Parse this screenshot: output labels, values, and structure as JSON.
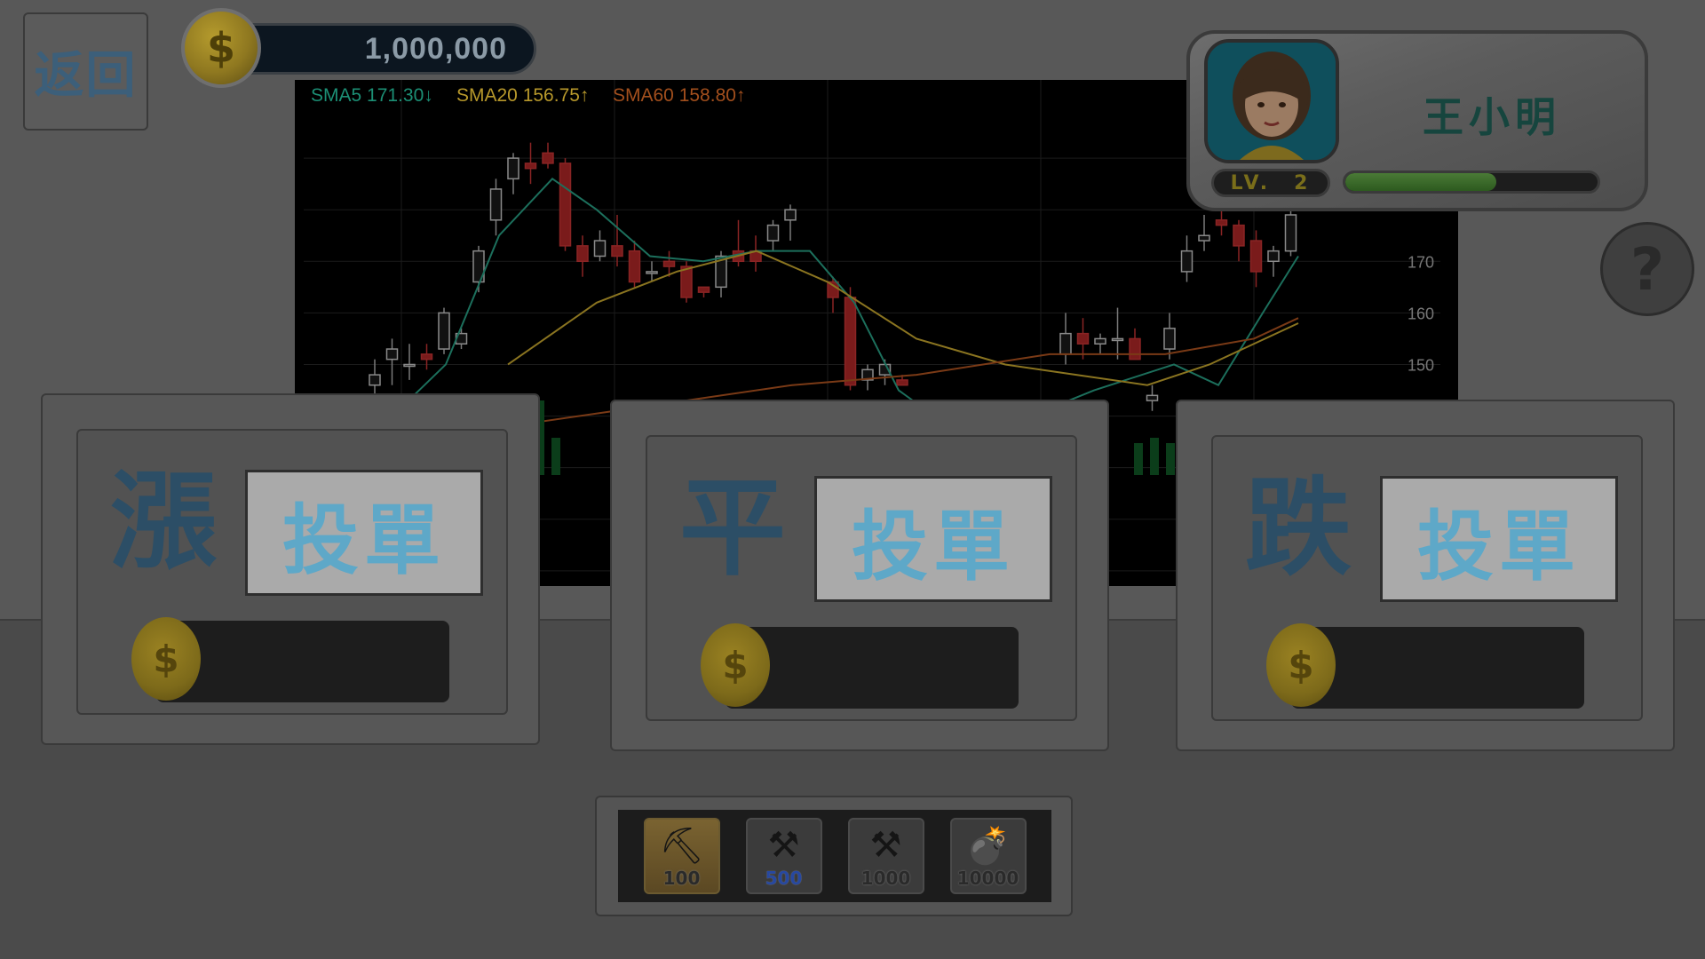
{
  "header": {
    "back_label": "返回",
    "coin_balance": "1,000,000",
    "coin_symbol": "$"
  },
  "chart_data": {
    "type": "candlestick",
    "indicators": [
      {
        "name": "SMA5",
        "value": "171.30",
        "direction": "down",
        "color": "#1c8f75"
      },
      {
        "name": "SMA20",
        "value": "156.75",
        "direction": "up",
        "color": "#b7982b"
      },
      {
        "name": "SMA60",
        "value": "158.80",
        "direction": "up",
        "color": "#a24f1d"
      }
    ],
    "y_ticks": [
      170,
      160,
      150
    ],
    "candles_visible_left": [
      {
        "o": 146,
        "h": 151,
        "l": 144,
        "c": 148
      },
      {
        "o": 151,
        "h": 155,
        "l": 146,
        "c": 153
      },
      {
        "o": 150,
        "h": 154,
        "l": 147,
        "c": 150
      },
      {
        "o": 152,
        "h": 154,
        "l": 149,
        "c": 151
      },
      {
        "o": 153,
        "h": 161,
        "l": 152,
        "c": 160
      },
      {
        "o": 154,
        "h": 157,
        "l": 153,
        "c": 156
      },
      {
        "o": 166,
        "h": 173,
        "l": 164,
        "c": 172
      },
      {
        "o": 178,
        "h": 186,
        "l": 175,
        "c": 184
      },
      {
        "o": 186,
        "h": 191,
        "l": 183,
        "c": 190
      },
      {
        "o": 189,
        "h": 193,
        "l": 185,
        "c": 188
      },
      {
        "o": 191,
        "h": 193,
        "l": 188,
        "c": 189
      },
      {
        "o": 189,
        "h": 190,
        "l": 172,
        "c": 173
      },
      {
        "o": 173,
        "h": 175,
        "l": 167,
        "c": 170
      },
      {
        "o": 171,
        "h": 176,
        "l": 170,
        "c": 174
      },
      {
        "o": 173,
        "h": 179,
        "l": 169,
        "c": 171
      },
      {
        "o": 172,
        "h": 174,
        "l": 165,
        "c": 166
      },
      {
        "o": 168,
        "h": 170,
        "l": 166,
        "c": 168
      },
      {
        "o": 170,
        "h": 172,
        "l": 167,
        "c": 169
      },
      {
        "o": 169,
        "h": 170,
        "l": 162,
        "c": 163
      },
      {
        "o": 165,
        "h": 165,
        "l": 163,
        "c": 164
      },
      {
        "o": 165,
        "h": 172,
        "l": 163,
        "c": 171
      },
      {
        "o": 172,
        "h": 178,
        "l": 169,
        "c": 170
      },
      {
        "o": 172,
        "h": 175,
        "l": 168,
        "c": 170
      },
      {
        "o": 174,
        "h": 178,
        "l": 172,
        "c": 177
      },
      {
        "o": 178,
        "h": 181,
        "l": 174,
        "c": 180
      }
    ],
    "candles_visible_right": [
      {
        "o": 166,
        "h": 167,
        "l": 160,
        "c": 163
      },
      {
        "o": 163,
        "h": 165,
        "l": 145,
        "c": 146
      },
      {
        "o": 147,
        "h": 150,
        "l": 145,
        "c": 149
      },
      {
        "o": 148,
        "h": 151,
        "l": 146,
        "c": 150
      },
      {
        "o": 147,
        "h": 148,
        "l": 146,
        "c": 146
      }
    ],
    "candles_far_right": [
      {
        "o": 152,
        "h": 160,
        "l": 150,
        "c": 156
      },
      {
        "o": 156,
        "h": 159,
        "l": 151,
        "c": 154
      },
      {
        "o": 154,
        "h": 156,
        "l": 152,
        "c": 155
      },
      {
        "o": 155,
        "h": 161,
        "l": 151,
        "c": 155
      },
      {
        "o": 155,
        "h": 157,
        "l": 151,
        "c": 151
      },
      {
        "o": 143,
        "h": 146,
        "l": 141,
        "c": 144
      },
      {
        "o": 153,
        "h": 160,
        "l": 151,
        "c": 157
      },
      {
        "o": 168,
        "h": 175,
        "l": 166,
        "c": 172
      },
      {
        "o": 174,
        "h": 179,
        "l": 172,
        "c": 175
      },
      {
        "o": 178,
        "h": 180,
        "l": 175,
        "c": 177
      },
      {
        "o": 177,
        "h": 178,
        "l": 170,
        "c": 173
      },
      {
        "o": 174,
        "h": 176,
        "l": 165,
        "c": 168
      },
      {
        "o": 170,
        "h": 173,
        "l": 167,
        "c": 172
      },
      {
        "o": 172,
        "h": 181,
        "l": 171,
        "c": 179
      }
    ]
  },
  "player": {
    "name": "王小明",
    "level_label": "LV.",
    "level": "2",
    "xp_fraction": 0.6
  },
  "help_label": "?",
  "bets": [
    {
      "direction": "漲",
      "order_label": "投單",
      "coin_symbol": "$"
    },
    {
      "direction": "平",
      "order_label": "投單",
      "coin_symbol": "$"
    },
    {
      "direction": "跌",
      "order_label": "投單",
      "coin_symbol": "$"
    }
  ],
  "tools": [
    {
      "price": "100",
      "icon": "shovel-icon",
      "glyph": "⛏",
      "selected": true
    },
    {
      "price": "500",
      "icon": "drill-icon",
      "glyph": "⚒",
      "selected": false
    },
    {
      "price": "1000",
      "icon": "drill-icon",
      "glyph": "⚒",
      "selected": false
    },
    {
      "price": "10000",
      "icon": "bomb-icon",
      "glyph": "💣",
      "selected": false
    }
  ]
}
